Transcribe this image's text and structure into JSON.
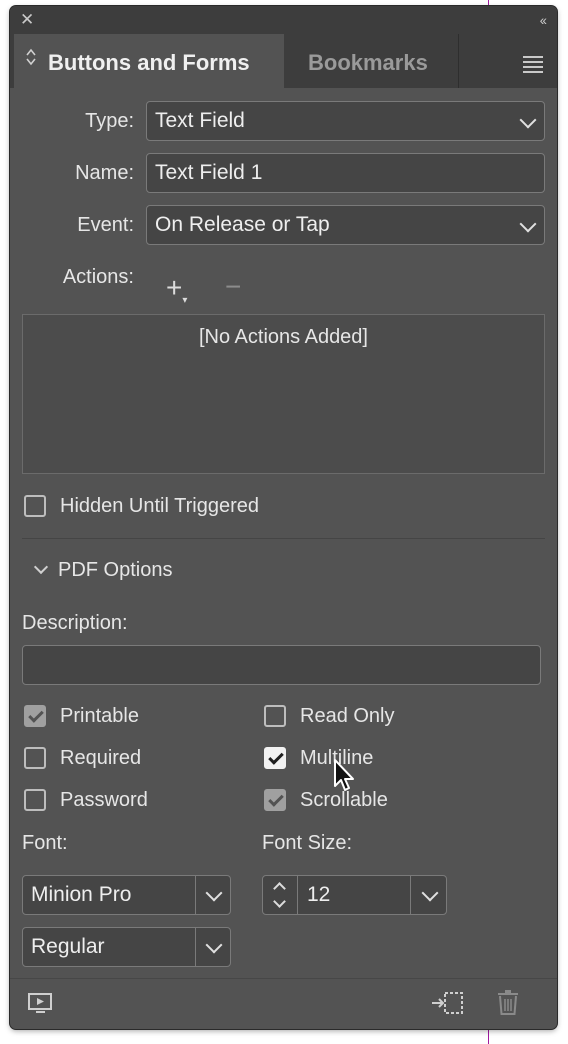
{
  "window": {
    "close_glyph": "✕",
    "collapse_glyph": "‹‹"
  },
  "tabs": [
    {
      "label": "Buttons and Forms",
      "active": true
    },
    {
      "label": "Bookmarks",
      "active": false
    }
  ],
  "form": {
    "type_label": "Type:",
    "type_value": "Text Field",
    "name_label": "Name:",
    "name_value": "Text Field 1",
    "event_label": "Event:",
    "event_value": "On Release or Tap",
    "actions_label": "Actions:",
    "actions_empty": "[No Actions Added]",
    "hidden_until_triggered": {
      "label": "Hidden Until Triggered",
      "checked": false
    }
  },
  "pdf_options": {
    "title": "PDF Options",
    "description_label": "Description:",
    "description_value": "",
    "checkboxes": {
      "printable": {
        "label": "Printable",
        "checked": true,
        "enabled": false
      },
      "read_only": {
        "label": "Read Only",
        "checked": false
      },
      "required": {
        "label": "Required",
        "checked": false
      },
      "multiline": {
        "label": "Multiline",
        "checked": true
      },
      "password": {
        "label": "Password",
        "checked": false
      },
      "scrollable": {
        "label": "Scrollable",
        "checked": true,
        "enabled": false
      }
    },
    "font_label": "Font:",
    "font_family": "Minion Pro",
    "font_style": "Regular",
    "font_size_label": "Font Size:",
    "font_size": "12"
  },
  "icons": {
    "add_action": "plus-icon",
    "remove_action": "minus-icon",
    "preview": "preview-spread-icon",
    "convert": "convert-to-button-icon",
    "delete": "trash-icon"
  },
  "colors": {
    "panel_bg": "#535353",
    "tabbar_bg": "#3d3d3d",
    "field_bg": "#454545",
    "text": "#e6e6e6",
    "guide": "#a01aa0"
  }
}
